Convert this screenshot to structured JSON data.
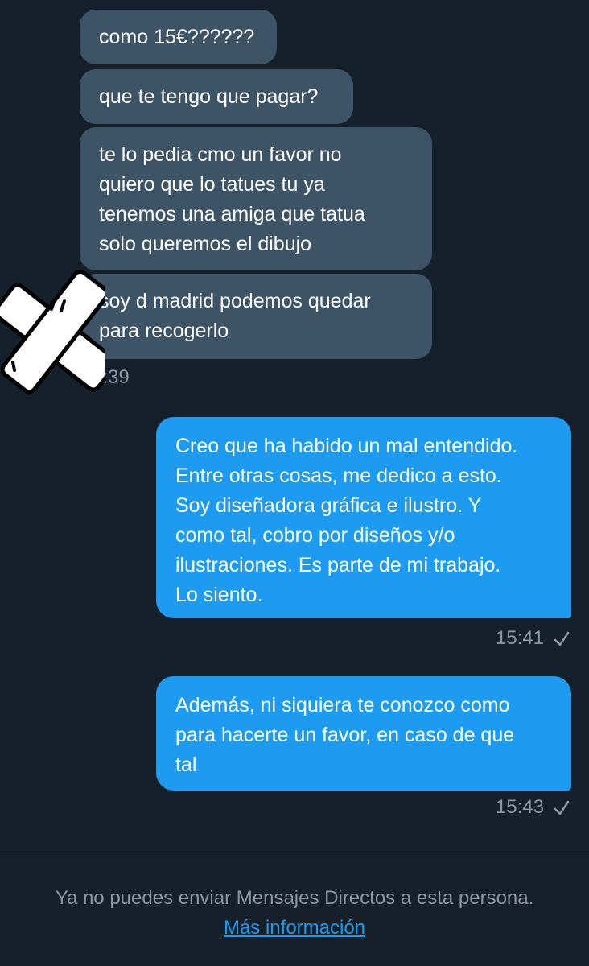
{
  "conversation": {
    "incoming": [
      {
        "text": "como 15€??????"
      },
      {
        "text": "que te tengo que pagar?"
      },
      {
        "text": "te lo pedia cmo un favor no\nquiero que lo tatues tu ya\ntenemos una amiga que tatua\nsolo queremos el dibujo"
      },
      {
        "text": "soy d madrid podemos quedar\npara recogerlo"
      }
    ],
    "incoming_time": "5:39",
    "outgoing": [
      {
        "text": "Creo que ha habido un mal entendido.\nEntre otras cosas, me dedico a esto.\nSoy diseñadora gráfica e ilustro. Y\ncomo tal, cobro por diseños y/o\nilustraciones. Es parte de mi trabajo.\nLo siento.",
        "time": "15:41"
      },
      {
        "text": "Además, ni siquiera te conozco como\npara hacerte un favor, en caso de que\ntal",
        "time": "15:43"
      }
    ]
  },
  "footer": {
    "notice": "Ya no puedes enviar Mensajes Directos a esta persona.",
    "link": "Más información"
  },
  "colors": {
    "background": "#15202b",
    "incoming_bubble": "#3d5466",
    "outgoing_bubble": "#1d9bf0",
    "muted_text": "#8b98a5",
    "link": "#1d9bf0"
  },
  "icons": [
    "bandage-x-sticker",
    "sent-check-icon"
  ]
}
